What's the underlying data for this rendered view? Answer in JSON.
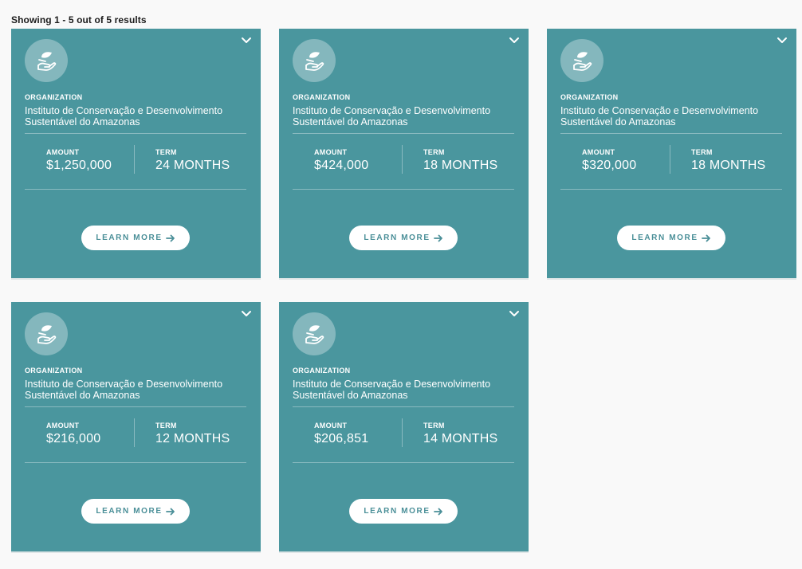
{
  "results_text": "Showing 1 - 5 out of 5 results",
  "colors": {
    "card_bg": "#4a969e",
    "button_text": "#4a8f98",
    "page_bg": "#f9f9f9"
  },
  "cards": [
    {
      "icon": "hand-leaf-icon",
      "org_label": "ORGANIZATION",
      "org_name": "Instituto de Conservação e Desenvolvimento Sustentável do Amazonas",
      "amount_label": "AMOUNT",
      "amount": "$1,250,000",
      "term_label": "TERM",
      "term": "24 MONTHS",
      "button_label": "LEARN MORE"
    },
    {
      "icon": "hand-leaf-icon",
      "org_label": "ORGANIZATION",
      "org_name": "Instituto de Conservação e Desenvolvimento Sustentável do Amazonas",
      "amount_label": "AMOUNT",
      "amount": "$424,000",
      "term_label": "TERM",
      "term": "18 MONTHS",
      "button_label": "LEARN MORE"
    },
    {
      "icon": "hand-leaf-icon",
      "org_label": "ORGANIZATION",
      "org_name": "Instituto de Conservação e Desenvolvimento Sustentável do Amazonas",
      "amount_label": "AMOUNT",
      "amount": "$320,000",
      "term_label": "TERM",
      "term": "18 MONTHS",
      "button_label": "LEARN MORE"
    },
    {
      "icon": "hand-leaf-icon",
      "org_label": "ORGANIZATION",
      "org_name": "Instituto de Conservação e Desenvolvimento Sustentável do Amazonas",
      "amount_label": "AMOUNT",
      "amount": "$216,000",
      "term_label": "TERM",
      "term": "12 MONTHS",
      "button_label": "LEARN MORE"
    },
    {
      "icon": "hand-leaf-icon",
      "org_label": "ORGANIZATION",
      "org_name": "Instituto de Conservação e Desenvolvimento Sustentável do Amazonas",
      "amount_label": "AMOUNT",
      "amount": "$206,851",
      "term_label": "TERM",
      "term": "14 MONTHS",
      "button_label": "LEARN MORE"
    }
  ]
}
